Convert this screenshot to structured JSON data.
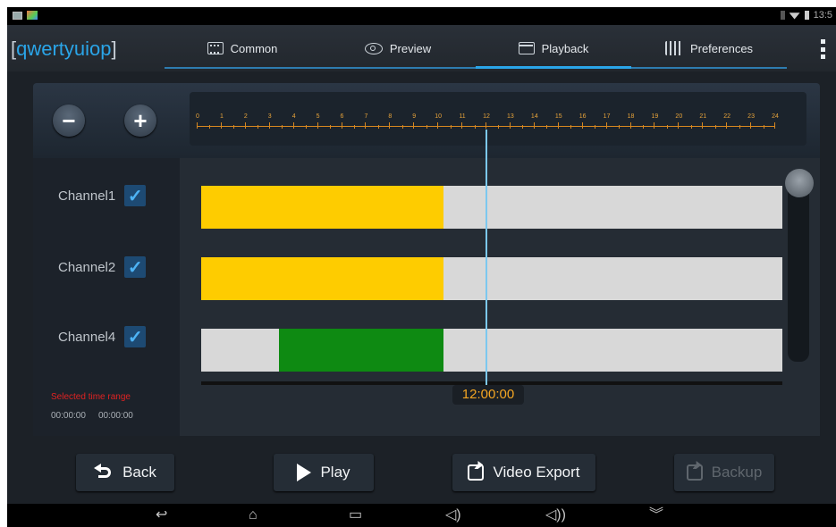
{
  "app": {
    "title_open": "[",
    "title_text": "qwertyuiop",
    "title_close": "]"
  },
  "statusbar": {
    "time": "13:5"
  },
  "tabs": [
    {
      "label": "Common",
      "icon": "common-icon"
    },
    {
      "label": "Preview",
      "icon": "preview-icon"
    },
    {
      "label": "Playback",
      "icon": "playback-icon",
      "active": true
    },
    {
      "label": "Preferences",
      "icon": "preferences-icon"
    }
  ],
  "ruler": {
    "hours": [
      "0",
      "1",
      "2",
      "3",
      "4",
      "5",
      "6",
      "7",
      "8",
      "9",
      "10",
      "11",
      "12",
      "13",
      "14",
      "15",
      "16",
      "17",
      "18",
      "19",
      "20",
      "21",
      "22",
      "23",
      "24"
    ]
  },
  "channels": [
    {
      "label": "Channel1",
      "checked": true,
      "segments": [
        {
          "start": 0,
          "end": 10,
          "color": "#fecc00"
        }
      ]
    },
    {
      "label": "Channel2",
      "checked": true,
      "segments": [
        {
          "start": 0,
          "end": 10,
          "color": "#fecc00"
        }
      ]
    },
    {
      "label": "Channel4",
      "checked": true,
      "segments": [
        {
          "start": 3.2,
          "end": 10,
          "color": "#0e8a12"
        }
      ]
    }
  ],
  "selection": {
    "title": "Selected time range",
    "start": "00:00:00",
    "end": "00:00:00"
  },
  "cursor": {
    "time": "12:00:00"
  },
  "buttons": {
    "back": "Back",
    "play": "Play",
    "video_export": "Video Export",
    "backup": "Backup"
  },
  "colors": {
    "accent": "#2aa5e8",
    "recording_normal": "#fecc00",
    "recording_motion": "#0e8a12",
    "ruler": "#e7a33a",
    "selection_label": "#e02222"
  }
}
